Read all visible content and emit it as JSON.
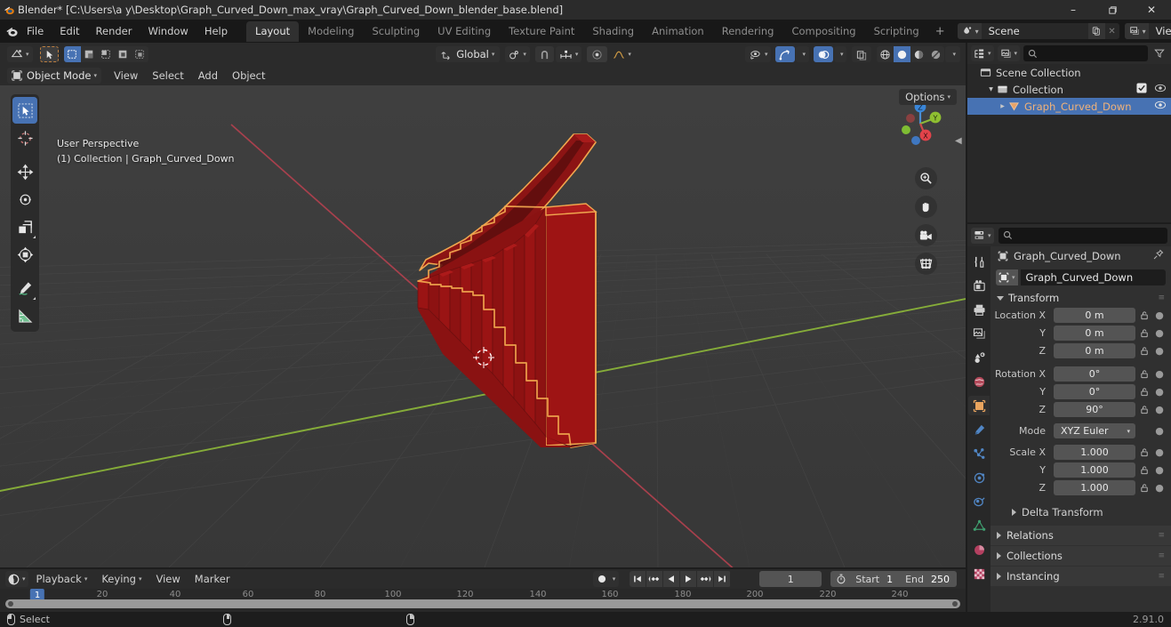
{
  "window": {
    "title": "Blender* [C:\\Users\\a y\\Desktop\\Graph_Curved_Down_max_vray\\Graph_Curved_Down_blender_base.blend]",
    "minimize": "–",
    "maximize": "❐",
    "close": "✕"
  },
  "menubar": {
    "items": [
      "File",
      "Edit",
      "Render",
      "Window",
      "Help"
    ],
    "workspaces": [
      {
        "label": "Layout",
        "active": true
      },
      {
        "label": "Modeling",
        "active": false
      },
      {
        "label": "Sculpting",
        "active": false
      },
      {
        "label": "UV Editing",
        "active": false
      },
      {
        "label": "Texture Paint",
        "active": false
      },
      {
        "label": "Shading",
        "active": false
      },
      {
        "label": "Animation",
        "active": false
      },
      {
        "label": "Rendering",
        "active": false
      },
      {
        "label": "Compositing",
        "active": false
      },
      {
        "label": "Scripting",
        "active": false
      }
    ],
    "add_workspace": "+",
    "scene_name": "Scene",
    "view_layer_name": "View Layer"
  },
  "viewport_header": {
    "editor_type": "3d-viewport-icon",
    "transform_orientation": "Global",
    "options_label": "Options",
    "snap_magnet": "magnet-icon",
    "proportional_edit": "proportional-editing-icon"
  },
  "viewport_header2": {
    "mode": "Object Mode",
    "menus": [
      "View",
      "Select",
      "Add",
      "Object"
    ]
  },
  "viewport": {
    "perspective_label": "User Perspective",
    "scene_label": "(1) Collection | Graph_Curved_Down",
    "gizmo_axes": [
      "X",
      "Y",
      "Z"
    ],
    "background_color": "#3b3b3b",
    "object_color": "#8f1212",
    "outline_color": "#f0a050",
    "x_axis_color": "#b84a5a",
    "y_axis_color": "#7ba428",
    "nav_buttons": [
      "zoom-icon",
      "pan-hand-icon",
      "camera-icon",
      "ortho-grid-icon"
    ]
  },
  "toolbar": {
    "tools": [
      {
        "name": "tweak-select-tool",
        "active": true
      },
      {
        "name": "cursor-tool",
        "active": false
      },
      {
        "name": "move-tool",
        "active": false
      },
      {
        "name": "rotate-tool",
        "active": false
      },
      {
        "name": "scale-tool",
        "active": false
      },
      {
        "name": "transform-tool",
        "active": false
      },
      {
        "name": "annotate-tool",
        "active": false
      },
      {
        "name": "measure-tool",
        "active": false
      }
    ]
  },
  "outliner": {
    "display_mode": "view-layer-icon",
    "filter_icon": "filter-icon",
    "search_placeholder": "",
    "rows": [
      {
        "label": "Scene Collection",
        "indent": 0,
        "icon": "collection-icon",
        "selected": false,
        "has_disclosure": false,
        "checkbox": false,
        "eye": false
      },
      {
        "label": "Collection",
        "indent": 1,
        "icon": "collection-icon",
        "selected": false,
        "has_disclosure": true,
        "checkbox": true,
        "eye": true
      },
      {
        "label": "Graph_Curved_Down",
        "indent": 2,
        "icon": "mesh-object-icon",
        "selected": true,
        "has_disclosure": true,
        "checkbox": false,
        "eye": true
      }
    ]
  },
  "properties": {
    "search_placeholder": "",
    "breadcrumb_object": "Graph_Curved_Down",
    "pin_icon": "pin-icon",
    "object_name_field": "Graph_Curved_Down",
    "tabs": [
      {
        "name": "tool-tab",
        "active": false
      },
      {
        "name": "render-tab",
        "active": false
      },
      {
        "name": "output-tab",
        "active": false
      },
      {
        "name": "view-layer-tab",
        "active": false
      },
      {
        "name": "scene-tab",
        "active": false
      },
      {
        "name": "world-tab",
        "active": false
      },
      {
        "name": "object-tab",
        "active": true
      },
      {
        "name": "modifier-tab",
        "active": false
      },
      {
        "name": "particles-tab",
        "active": false
      },
      {
        "name": "physics-tab",
        "active": false
      },
      {
        "name": "constraints-tab",
        "active": false
      },
      {
        "name": "data-tab",
        "active": false
      },
      {
        "name": "material-tab",
        "active": false
      },
      {
        "name": "texture-tab",
        "active": false
      }
    ],
    "transform_panel": {
      "title": "Transform",
      "location": {
        "label": "Location X",
        "x": "0 m",
        "y": "0 m",
        "z": "0 m"
      },
      "rotation": {
        "label": "Rotation X",
        "x": "0°",
        "y": "0°",
        "z": "90°"
      },
      "axis_y": "Y",
      "axis_z": "Z",
      "mode_label": "Mode",
      "mode_value": "XYZ Euler",
      "scale": {
        "label": "Scale X",
        "x": "1.000",
        "y": "1.000",
        "z": "1.000"
      },
      "delta_transform": "Delta Transform"
    },
    "closed_panels": [
      "Relations",
      "Collections",
      "Instancing"
    ]
  },
  "timeline": {
    "editor_type": "timeline-icon",
    "menus": [
      "Playback",
      "Keying",
      "View",
      "Marker"
    ],
    "auto_key": "record-icon",
    "playback_buttons": [
      "jump-to-start",
      "jump-prev-keyframe",
      "play-reverse",
      "play",
      "jump-next-keyframe",
      "jump-to-end"
    ],
    "current_frame": "1",
    "start_label": "Start",
    "start_value": "1",
    "end_label": "End",
    "end_value": "250",
    "ticks": [
      "20",
      "40",
      "60",
      "80",
      "100",
      "120",
      "140",
      "160",
      "180",
      "200",
      "220",
      "240"
    ],
    "playhead_frame": "1"
  },
  "statusbar": {
    "mouse_left_label": "Select",
    "mouse_middle_label": "",
    "mouse_right_label": "",
    "version": "2.91.0"
  },
  "colors": {
    "accent_blue": "#4772b3",
    "panel_dark": "#303030",
    "header_dark": "#2b2b2b",
    "window_bg": "#1d1d1d",
    "field_gray": "#545454",
    "text": "#e0e0e0"
  }
}
